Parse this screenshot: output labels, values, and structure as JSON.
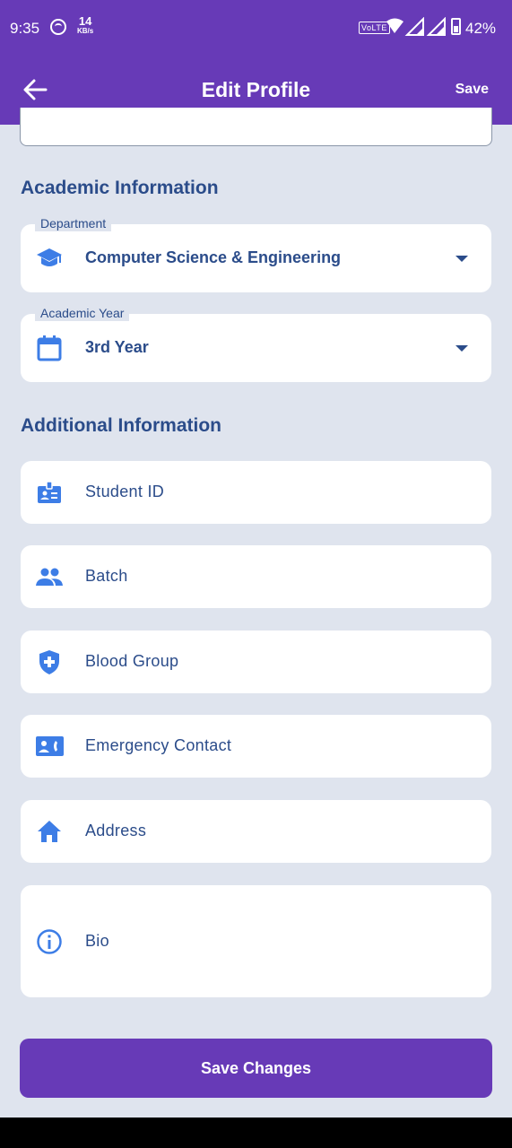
{
  "status_bar": {
    "time": "9:35",
    "speed_value": "14",
    "speed_unit": "KB/s",
    "network": "VoLTE",
    "battery": "42%"
  },
  "header": {
    "title": "Edit Profile",
    "save_label": "Save",
    "back_icon": "arrow-left-icon"
  },
  "academic": {
    "section_title": "Academic Information",
    "department": {
      "label": "Department",
      "value": "Computer Science & Engineering",
      "icon": "school-icon"
    },
    "year": {
      "label": "Academic Year",
      "value": "3rd Year",
      "icon": "calendar-icon"
    }
  },
  "additional": {
    "section_title": "Additional Information",
    "fields": [
      {
        "label": "Student ID",
        "icon": "badge-icon"
      },
      {
        "label": "Batch",
        "icon": "group-icon"
      },
      {
        "label": "Blood Group",
        "icon": "medical-shield-icon"
      },
      {
        "label": "Emergency Contact",
        "icon": "contact-phone-icon"
      },
      {
        "label": "Address",
        "icon": "home-icon"
      },
      {
        "label": "Bio",
        "icon": "info-icon"
      }
    ]
  },
  "save_button_label": "Save Changes",
  "colors": {
    "primary": "#673ab7",
    "background": "#dfe4ee",
    "text": "#2b4c8a",
    "icon": "#3d7de6"
  }
}
